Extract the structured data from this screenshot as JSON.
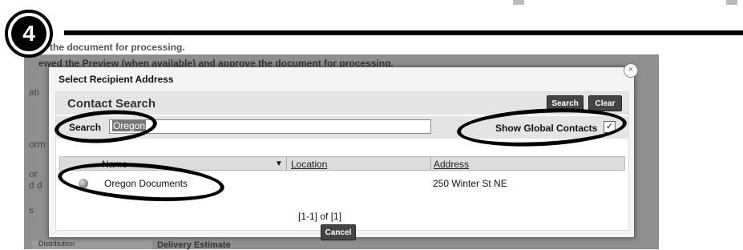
{
  "step": {
    "number": "4"
  },
  "background": {
    "heading_fragment": "the document for processing.",
    "instruction": "ewed the Preview (when available) and approve the document for processing.",
    "left_fragments": [
      "ati",
      "orm",
      "or",
      "d d",
      "s",
      "Distribution"
    ],
    "delivery_label": "Delivery Estimate"
  },
  "dialog": {
    "title": "Select Recipient Address",
    "close_glyph": "×",
    "panel_title": "Contact Search",
    "search_button": "Search",
    "clear_button": "Clear",
    "search_label": "Search",
    "search_value": "Oregon",
    "show_global_label": "Show Global Contacts",
    "show_global_checked": true,
    "columns": [
      "Name",
      "Location",
      "Address"
    ],
    "rows": [
      {
        "name": "Oregon Documents",
        "location": "",
        "address": "250 Winter St NE"
      }
    ],
    "pager": "[1-1] of [1]",
    "cancel_button": "Cancel"
  }
}
